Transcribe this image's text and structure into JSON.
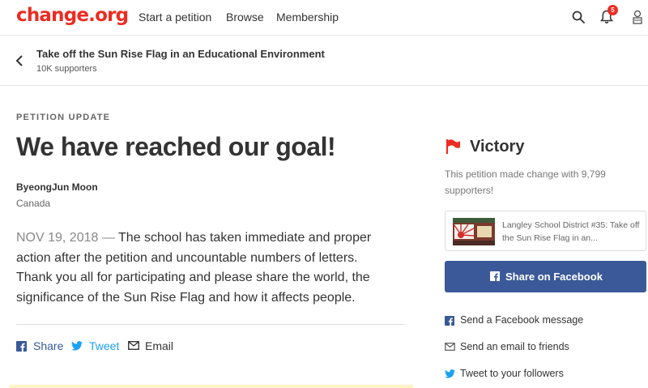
{
  "nav": {
    "logo": "change.org",
    "links": [
      "Start a petition",
      "Browse",
      "Membership"
    ],
    "notification_count": "5",
    "icons": [
      "search-icon",
      "bell-icon",
      "avatar"
    ]
  },
  "petition_bar": {
    "title": "Take off the Sun Rise Flag in an Educational Environment",
    "supporters": "10K supporters"
  },
  "update": {
    "eyebrow": "PETITION UPDATE",
    "headline": "We have reached our goal!",
    "author": "ByeongJun Moon",
    "country": "Canada",
    "date": "NOV 19, 2018",
    "separator": " — ",
    "body": "The school has taken immediate and proper action after the petition and uncountable numbers of letters. Thank you all for participating and please share the world, the significance of the Sun Rise Flag and how it affects people."
  },
  "share": {
    "facebook": "Share",
    "twitter": "Tweet",
    "email": "Email"
  },
  "sidebar": {
    "status": "Victory",
    "status_text": "This petition made change with 9,799 supporters!",
    "card_text": "Langley School District #35: Take off the Sun Rise Flag in an...",
    "fb_button": "Share on Facebook",
    "links": [
      "Send a Facebook message",
      "Send an email to friends",
      "Tweet to your followers"
    ]
  },
  "colors": {
    "brand": "#ec2c22",
    "facebook": "#3b5998",
    "twitter": "#1da1f2"
  }
}
